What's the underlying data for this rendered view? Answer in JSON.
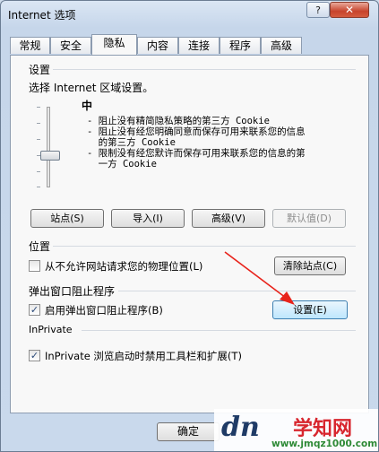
{
  "window": {
    "title": "Internet 选项",
    "help_label": "?",
    "close_label": "✕"
  },
  "tabs": [
    "常规",
    "安全",
    "隐私",
    "内容",
    "连接",
    "程序",
    "高级"
  ],
  "settings": {
    "legend": "设置",
    "instruction": "选择 Internet 区域设置。",
    "level": "中",
    "descriptions": [
      "- 阻止没有精简隐私策略的第三方 Cookie",
      "- 阻止没有经您明确同意而保存可用来联系您的信息",
      "  的第三方 Cookie",
      "- 限制没有经您默许而保存可用来联系您的信息的第",
      "  一方 Cookie"
    ],
    "buttons": {
      "sites": "站点(S)",
      "import": "导入(I)",
      "advanced": "高级(V)",
      "default": "默认值(D)"
    }
  },
  "location": {
    "legend": "位置",
    "checkbox_label": "从不允许网站请求您的物理位置(L)",
    "clear_button": "清除站点(C)"
  },
  "popup": {
    "legend": "弹出窗口阻止程序",
    "checkbox_label": "启用弹出窗口阻止程序(B)",
    "settings_button": "设置(E)"
  },
  "inprivate": {
    "legend": "InPrivate",
    "checkbox_label": "InPrivate 浏览启动时禁用工具栏和扩展(T)"
  },
  "footer": {
    "ok_label": "确定"
  },
  "watermark": {
    "site_name": "学知网",
    "url": "www.jmqz1000.com",
    "logo_text": "dn"
  },
  "colors": {
    "arrow": "#e8231b",
    "watermark_red": "#d8262e",
    "watermark_green": "#2d8a35",
    "watermark_logo": "#1f3b66"
  }
}
